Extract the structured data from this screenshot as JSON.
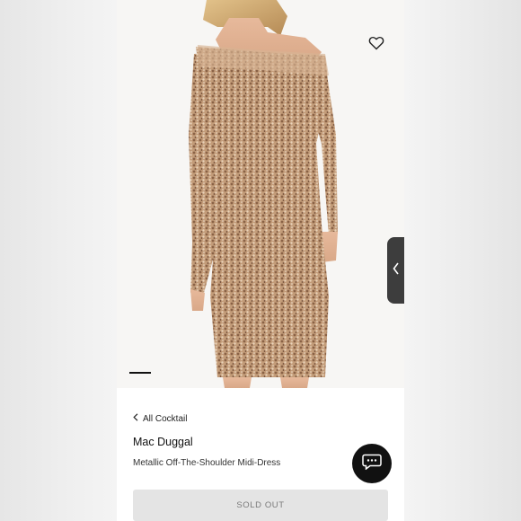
{
  "gallery": {
    "image_alt": "Model wearing a metallic sequin off-the-shoulder midi dress",
    "favorite_icon": "heart-icon",
    "current_image": 1
  },
  "breadcrumb": {
    "icon": "chevron-left-icon",
    "label": "All Cocktail"
  },
  "product": {
    "brand": "Mac Duggal",
    "name": "Metallic Off-The-Shoulder Midi-Dress",
    "button_label": "SOLD OUT"
  },
  "chat": {
    "icon": "chat-bubble-icon"
  },
  "side_tab": {
    "icon": "chevron-left-icon"
  },
  "colors": {
    "accent": "#111111",
    "dress": "#c8a07e",
    "sold_out_bg": "#e4e4e4",
    "sold_out_text": "#7a7a7a"
  }
}
